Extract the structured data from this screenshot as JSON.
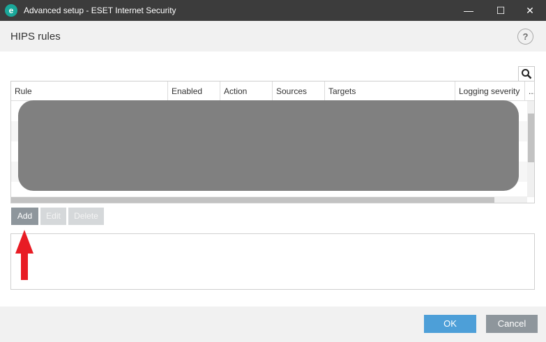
{
  "window": {
    "title": "Advanced setup - ESET Internet Security",
    "app_icon_letter": "e",
    "minimize": "—",
    "maximize": "☐",
    "close": "✕"
  },
  "header": {
    "title": "HIPS rules",
    "help_label": "?"
  },
  "table": {
    "columns": [
      "Rule",
      "Enabled",
      "Action",
      "Sources",
      "Targets",
      "Logging severity",
      "..."
    ],
    "rows_redacted": true
  },
  "toolbar": {
    "add_label": "Add",
    "edit_label": "Edit",
    "delete_label": "Delete"
  },
  "footer": {
    "ok_label": "OK",
    "cancel_label": "Cancel"
  },
  "colors": {
    "titlebar": "#3c3c3c",
    "app_icon": "#1aa89a",
    "ok_button": "#4d9fd8",
    "neutral_button": "#8e969c",
    "annotation_arrow": "#e81c24"
  }
}
